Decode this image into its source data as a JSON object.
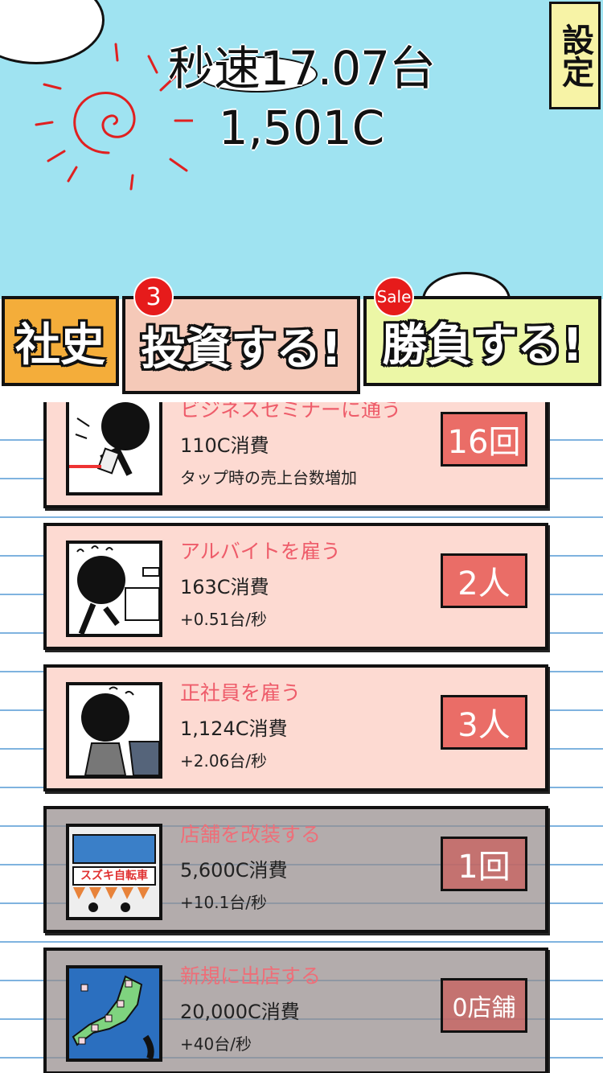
{
  "header": {
    "rate": "秒速17.07台",
    "money": "1,501C",
    "settings_label": "設定"
  },
  "tabs": [
    {
      "label": "社史"
    },
    {
      "label": "投資する!"
    },
    {
      "label": "勝負する!"
    }
  ],
  "badges": {
    "invest_count": "3",
    "sale_label": "Sale"
  },
  "items": [
    {
      "title": "ビジネスセミナーに通う",
      "cost": "110C消費",
      "effect": "タップ時の売上台数増加",
      "count": "16回",
      "locked": false
    },
    {
      "title": "アルバイトを雇う",
      "cost": "163C消費",
      "effect": "+0.51台/秒",
      "count": "2人",
      "locked": false
    },
    {
      "title": "正社員を雇う",
      "cost": "1,124C消費",
      "effect": "+2.06台/秒",
      "count": "3人",
      "locked": false
    },
    {
      "title": "店舗を改装する",
      "cost": "5,600C消費",
      "effect": "+10.1台/秒",
      "count": "1回",
      "locked": true
    },
    {
      "title": "新規に出店する",
      "cost": "20,000C消費",
      "effect": "+40台/秒",
      "count": "0店舗",
      "locked": true
    }
  ],
  "shop_sign": "スズキ自転車"
}
